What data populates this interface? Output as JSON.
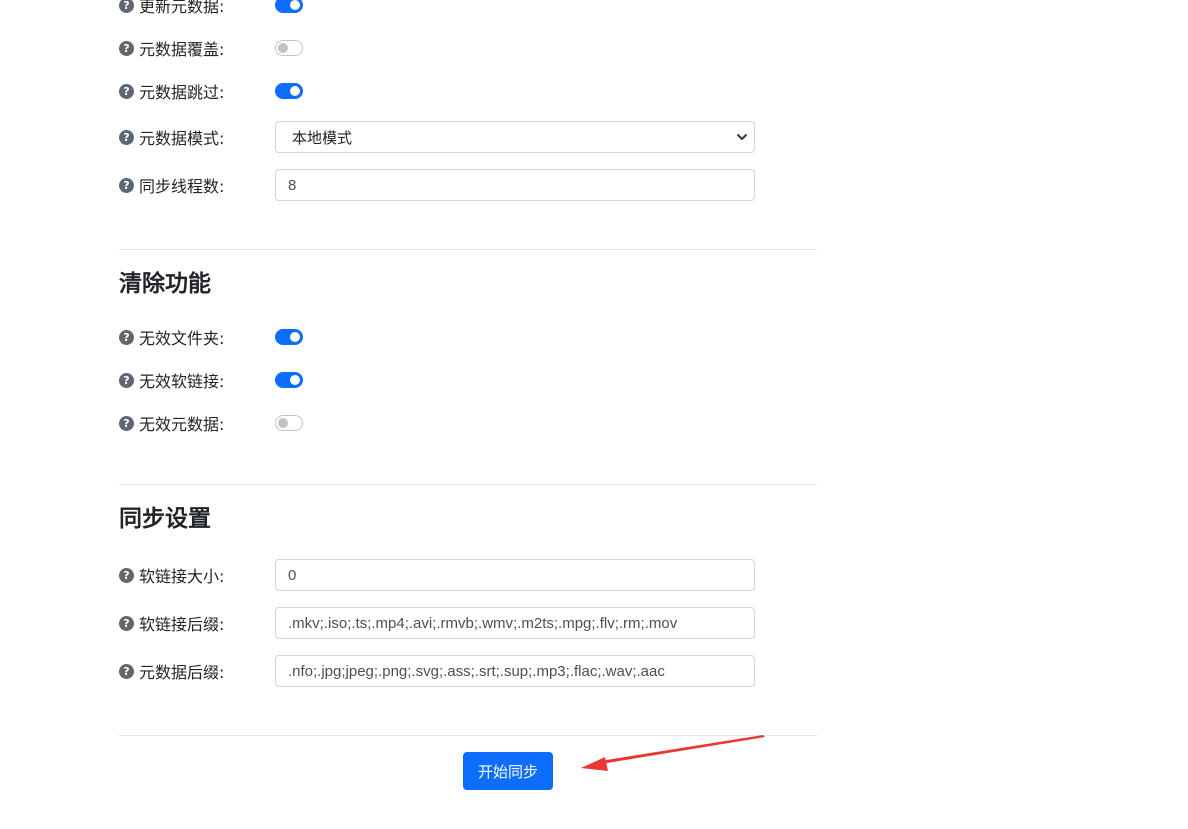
{
  "metadata_section": {
    "rows": [
      {
        "label": "更新元数据:",
        "toggle": true
      },
      {
        "label": "元数据覆盖:",
        "toggle": false
      },
      {
        "label": "元数据跳过:",
        "toggle": true
      }
    ],
    "mode": {
      "label": "元数据模式:",
      "value": "本地模式"
    },
    "threads": {
      "label": "同步线程数:",
      "value": "8"
    }
  },
  "clean_section": {
    "title": "清除功能",
    "rows": [
      {
        "label": "无效文件夹:",
        "toggle": true
      },
      {
        "label": "无效软链接:",
        "toggle": true
      },
      {
        "label": "无效元数据:",
        "toggle": false
      }
    ]
  },
  "sync_section": {
    "title": "同步设置",
    "symlink_size": {
      "label": "软链接大小:",
      "value": "0"
    },
    "symlink_ext": {
      "label": "软链接后缀:",
      "value": ".mkv;.iso;.ts;.mp4;.avi;.rmvb;.wmv;.m2ts;.mpg;.flv;.rm;.mov"
    },
    "meta_ext": {
      "label": "元数据后缀:",
      "value": ".nfo;.jpg;jpeg;.png;.svg;.ass;.srt;.sup;.mp3;.flac;.wav;.aac"
    }
  },
  "actions": {
    "start_label": "开始同步"
  },
  "help_glyph": "?",
  "icons": {
    "help": "question-circle-icon",
    "select": "chevron-down-icon",
    "annotation": "red-arrow"
  },
  "colors": {
    "primary": "#0d6efd",
    "annotation": "#e8382f",
    "help": "#5f6770"
  }
}
